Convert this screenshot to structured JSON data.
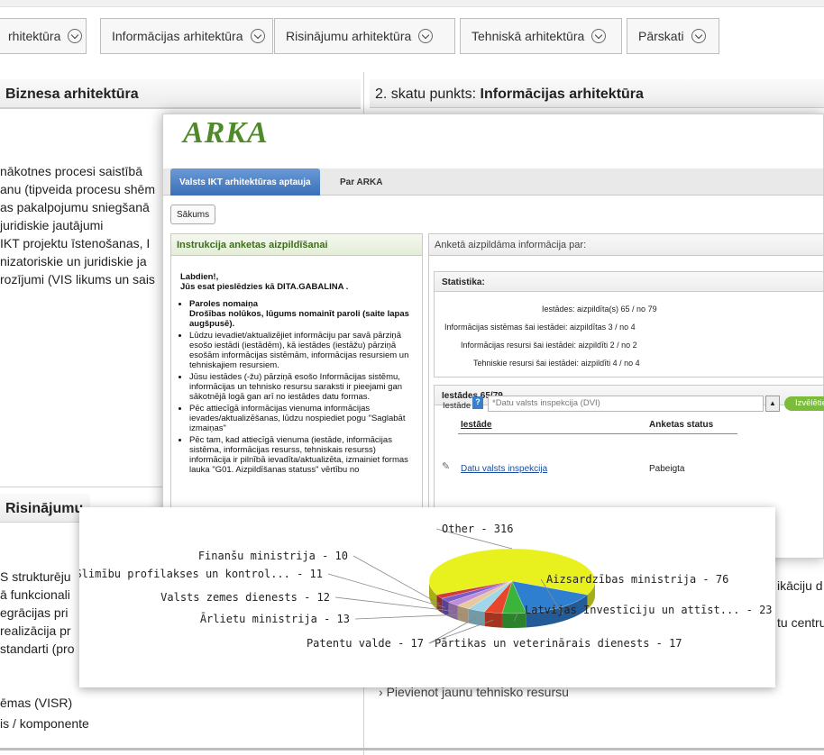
{
  "nav": {
    "tabs": [
      "rhitektūra",
      "Informācijas arhitektūra",
      "Risinājumu arhitektūra",
      "Tehniskā arhitektūra",
      "Pārskati"
    ]
  },
  "left_panel": {
    "title": "Biznesa arhitektūra",
    "lines": [
      "nākotnes procesi saistībā",
      "anu (tipveida procesu shēm",
      "as pakalpojumu sniegšanā",
      "juridiskie jautājumi",
      "IKT projektu īstenošanas, I",
      "nizatoriskie un juridiskie ja",
      "rozījumi (VIS likums un sais"
    ]
  },
  "right_panel": {
    "title_prefix": "2. skatu punkts: ",
    "title_bold": "Informācijas arhitektūra"
  },
  "lower_left": {
    "title": "Risinājumu",
    "lines": [
      "S strukturēju",
      "ā funkcionali",
      "egrācijas pri",
      "realizācija pr",
      "standarti (pro"
    ],
    "bottom_lines": [
      "ēmas (VISR)",
      "is / komponente"
    ]
  },
  "lower_right": {
    "snip1": "ikāciju d",
    "snip2": "tu centru",
    "link": "Pievienot jaunu tehnisko resursu"
  },
  "arka": {
    "logo": "ARKA",
    "tabs": [
      "Valsts IKT arhitektūras aptauja",
      "Par ARKA"
    ],
    "home_button": "Sākums",
    "instructions": {
      "header": "Instrukcija anketas aizpildīšanai",
      "greeting": "Labdien!,",
      "logged_in": "Jūs esat pieslēdzies kā DITA.GABALINA .",
      "items": [
        "Paroles nomaiņa\nDrošības nolūkos, lūgums nomainīt paroli (saite lapas augšpusē).",
        "Lūdzu ievadiet/aktualizējiet informāciju par savā pārziņā esošo iestādi (iestādēm), kā iestādes (iestāžu) pārziņā esošām informācijas sistēmām, informācijas resursiem un tehniskajiem resursiem.",
        "Jūsu iestādes (-žu) pārziņā esošo Informācijas sistēmu, informācijas un tehnisko resursu saraksti ir pieejami gan sākotnējā logā gan arī no iestādes datu formas.",
        "Pēc attiecīgā informācijas vienuma informācijas ievades/aktualizēšanas, lūdzu nospiediet pogu \"Saglabāt izmaiņas\"",
        "Pēc tam, kad attiecīgā vienuma (iestāde, informācijas sistēma, informācijas resurss, tehniskais resurss) informācija ir pilnībā ievadīta/aktualizēta, izmainiet formas lauka \"G01. Aizpildīšanas statuss\" vērtību no"
      ]
    },
    "info": {
      "header": "Anketā aizpildāma informācija par:",
      "stats_header": "Statistika:",
      "stats": [
        "Iestādes: aizpildīta(s) 65 / no 79",
        "Informācijas sistēmas šai iestādei: aizpildītas 3 / no 4",
        "Informācijas resursi šai iestādei: aizpildīti 2 / no 2",
        "Tehniskie resursi šai iestādei: aizpildīti 4 / no 4"
      ],
      "institutions_header": "Iestādes 65/79",
      "institution_label": "Iestāde",
      "help": "?",
      "combo_value": "*Datu valsts inspekcija (DVI)",
      "select_button": "Izvēlēties",
      "table_headers": [
        "Iestāde",
        "Anketas status"
      ],
      "rows": [
        {
          "name": "Datu valsts inspekcija",
          "status": "Pabeigta"
        }
      ]
    }
  },
  "chart_data": {
    "type": "pie",
    "slices": [
      {
        "label": "Other",
        "value": 316,
        "color": "#e8f01e"
      },
      {
        "label": "Aizsardzības ministrija",
        "value": 76,
        "color": "#2f7fd0"
      },
      {
        "label": "Latvijas Investīciju un attīst...",
        "value": 23,
        "color": "#3cb43c"
      },
      {
        "label": "Pārtikas un veterinārais dienests",
        "value": 17,
        "color": "#e8462a"
      },
      {
        "label": "Patentu valde",
        "value": 17,
        "color": "#9fd6e8"
      },
      {
        "label": "Ārlietu ministrija",
        "value": 13,
        "color": "#e8c8a0"
      },
      {
        "label": "Valsts zemes dienests",
        "value": 12,
        "color": "#c08fd8"
      },
      {
        "label": "Slimību profilakses un kontrol...",
        "value": 11,
        "color": "#7a5cc8"
      },
      {
        "label": "Finanšu ministrija",
        "value": 10,
        "color": "#d03a3a"
      }
    ]
  }
}
